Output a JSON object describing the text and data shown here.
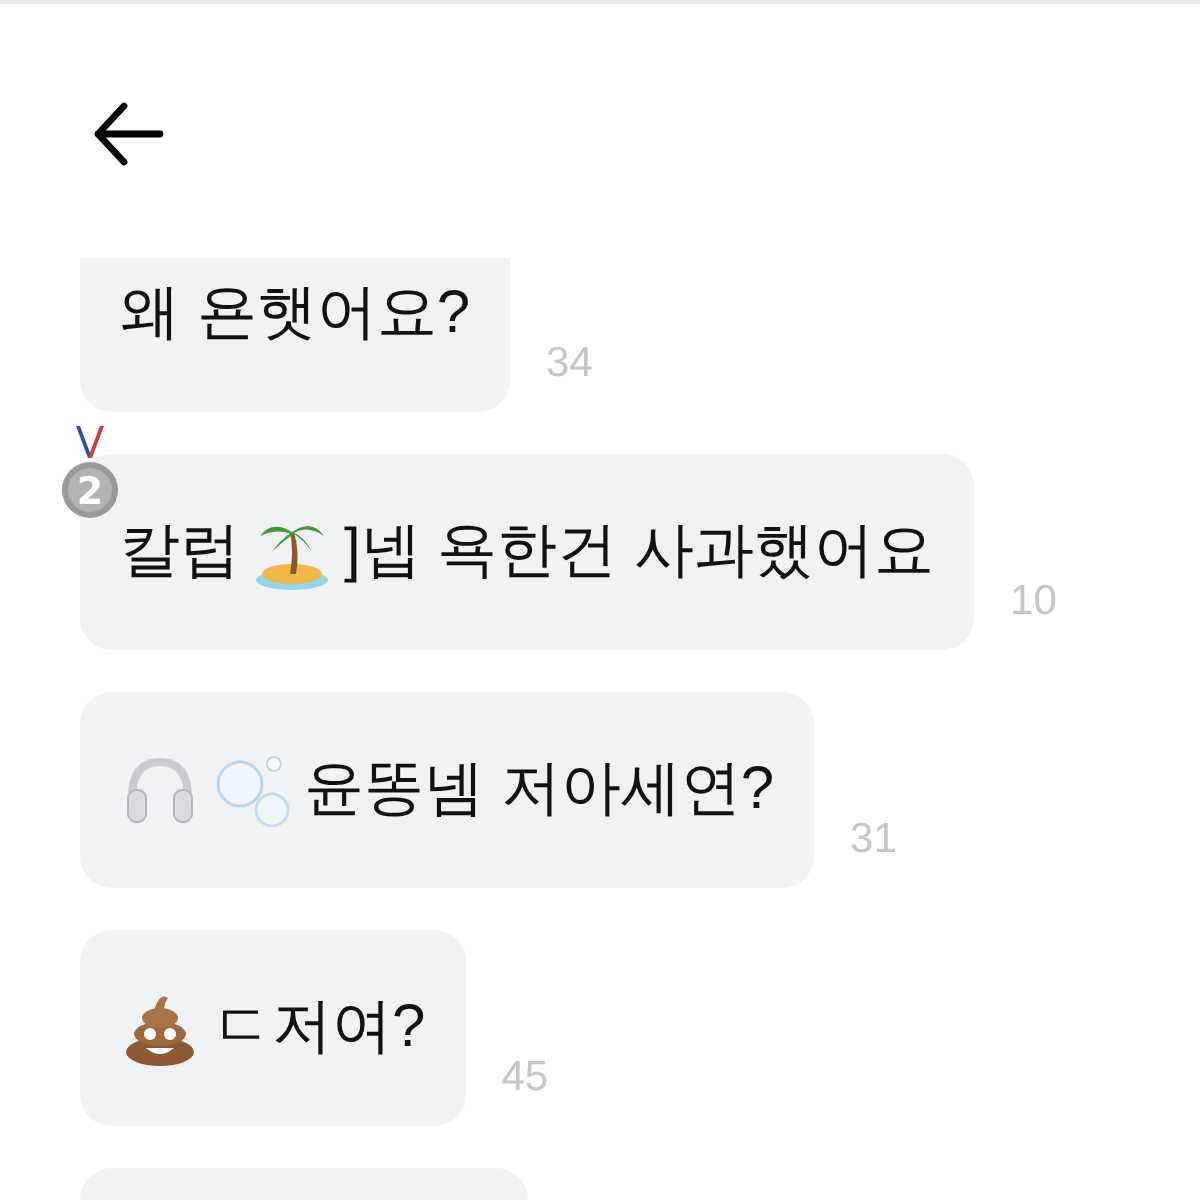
{
  "messages": [
    {
      "kind": "full",
      "parts": [
        {
          "kind": "text",
          "text": "왜 욘햇어요?"
        }
      ],
      "time": "34"
    },
    {
      "kind": "full",
      "badge": {
        "kind": "medal",
        "label": "2"
      },
      "parts": [
        {
          "kind": "text",
          "text": "칼럽"
        },
        {
          "kind": "island"
        },
        {
          "kind": "text",
          "text": "]넵 욕한건 사과했어요"
        }
      ],
      "time": "10"
    },
    {
      "kind": "full",
      "parts": [
        {
          "kind": "headphones"
        },
        {
          "kind": "bubbles"
        },
        {
          "kind": "text",
          "text": "윤똥넴 저아세연?"
        }
      ],
      "time": "31"
    },
    {
      "kind": "full",
      "parts": [
        {
          "kind": "poo"
        },
        {
          "kind": "text",
          "text": "ㄷ저여?"
        }
      ],
      "time": "45"
    },
    {
      "kind": "clipped"
    }
  ]
}
